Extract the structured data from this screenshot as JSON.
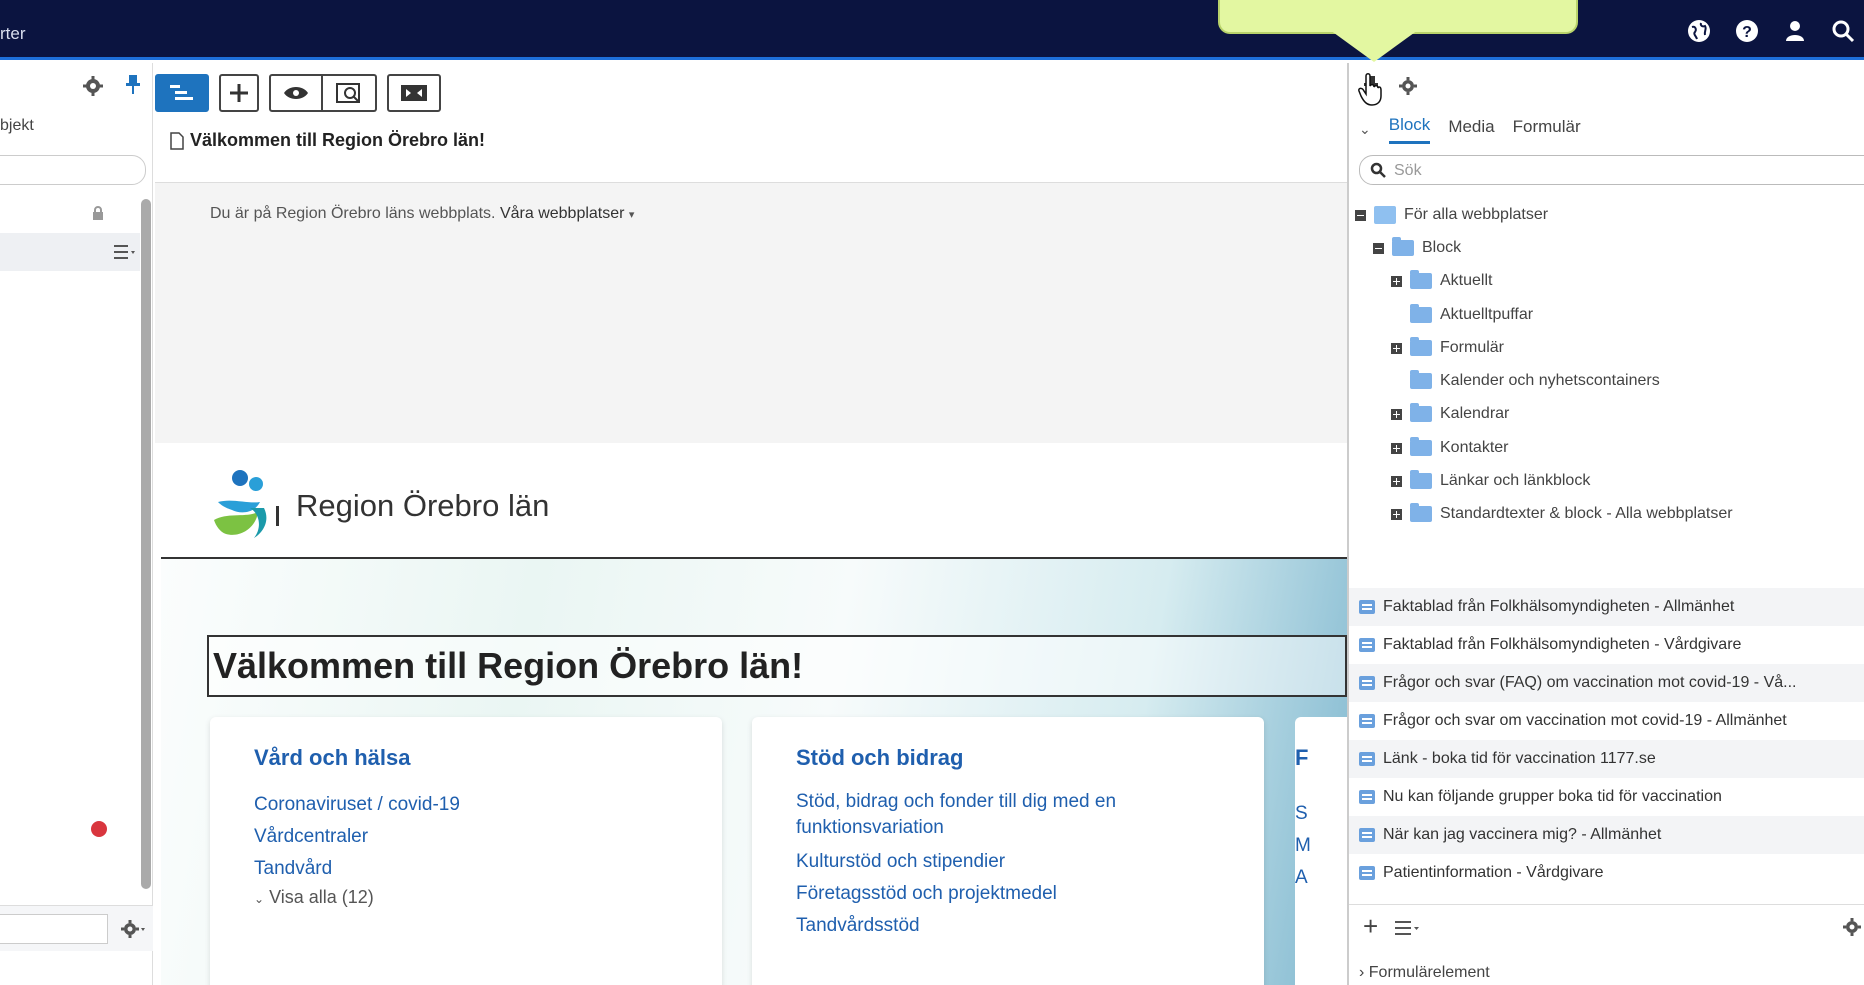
{
  "topbar": {
    "crumb": "rter",
    "icons": [
      "globe-icon",
      "help-icon",
      "user-icon",
      "search-icon"
    ],
    "colors": {
      "bg": "#0b1440",
      "accent": "#1e6fd9",
      "callout": "#e3f7a1"
    }
  },
  "left_panel": {
    "objekt_label": "bjekt"
  },
  "editor": {
    "page_title": "Välkommen till Region Örebro län!",
    "toolbar": [
      "tree-toggle-icon",
      "add-icon",
      "preview-eye-icon",
      "preview-window-icon",
      "compare-icon"
    ]
  },
  "preview": {
    "sitebar_text": "Du är på Region Örebro läns webbplats.",
    "sitebar_link": "Våra webbplatser",
    "logo_text": "Region Örebro län",
    "welcome": "Välkommen till Region Örebro län!",
    "cards": [
      {
        "title": "Vård och hälsa",
        "links": [
          "Coronaviruset / covid-19",
          "Vårdcentraler",
          "Tandvård"
        ],
        "more": "Visa alla (12)"
      },
      {
        "title": "Stöd och bidrag",
        "links": [
          "Stöd, bidrag och fonder till dig med en funktionsvariation",
          "Kulturstöd och stipendier",
          "Företagsstöd och projektmedel",
          "Tandvårdsstöd"
        ]
      }
    ],
    "card3_fragments": [
      "F",
      "S",
      "M",
      "A"
    ]
  },
  "right_panel": {
    "tabs": [
      "Block",
      "Media",
      "Formulär"
    ],
    "active_tab": "Block",
    "search_placeholder": "Sök",
    "tree": [
      {
        "label": "För alla webbplatser",
        "toggle": "minus",
        "icon": "site"
      },
      {
        "label": "Block",
        "toggle": "minus",
        "icon": "folder"
      },
      {
        "label": "Aktuellt",
        "toggle": "plus",
        "icon": "folder"
      },
      {
        "label": "Aktuelltpuffar",
        "toggle": "none",
        "icon": "folder"
      },
      {
        "label": "Formulär",
        "toggle": "plus",
        "icon": "folder"
      },
      {
        "label": "Kalender och nyhetscontainers",
        "toggle": "none",
        "icon": "folder"
      },
      {
        "label": "Kalendrar",
        "toggle": "plus",
        "icon": "folder"
      },
      {
        "label": "Kontakter",
        "toggle": "plus",
        "icon": "folder"
      },
      {
        "label": "Länkar och länkblock",
        "toggle": "plus",
        "icon": "folder"
      },
      {
        "label": "Standardtexter & block - Alla webbplatser",
        "toggle": "plus",
        "icon": "folder"
      }
    ],
    "items": [
      "Faktablad från Folkhälsomyndigheten - Allmänhet",
      "Faktablad från Folkhälsomyndigheten - Vårdgivare",
      "Frågor och svar (FAQ) om vaccination mot covid-19 - Vå...",
      "Frågor och svar om vaccination mot covid-19 - Allmänhet",
      "Länk - boka tid för vaccination 1177.se",
      "Nu kan följande grupper boka tid för vaccination",
      "När kan jag vaccinera mig? - Allmänhet",
      "Patientinformation - Vårdgivare"
    ],
    "footer_section": "Formulärelement"
  }
}
